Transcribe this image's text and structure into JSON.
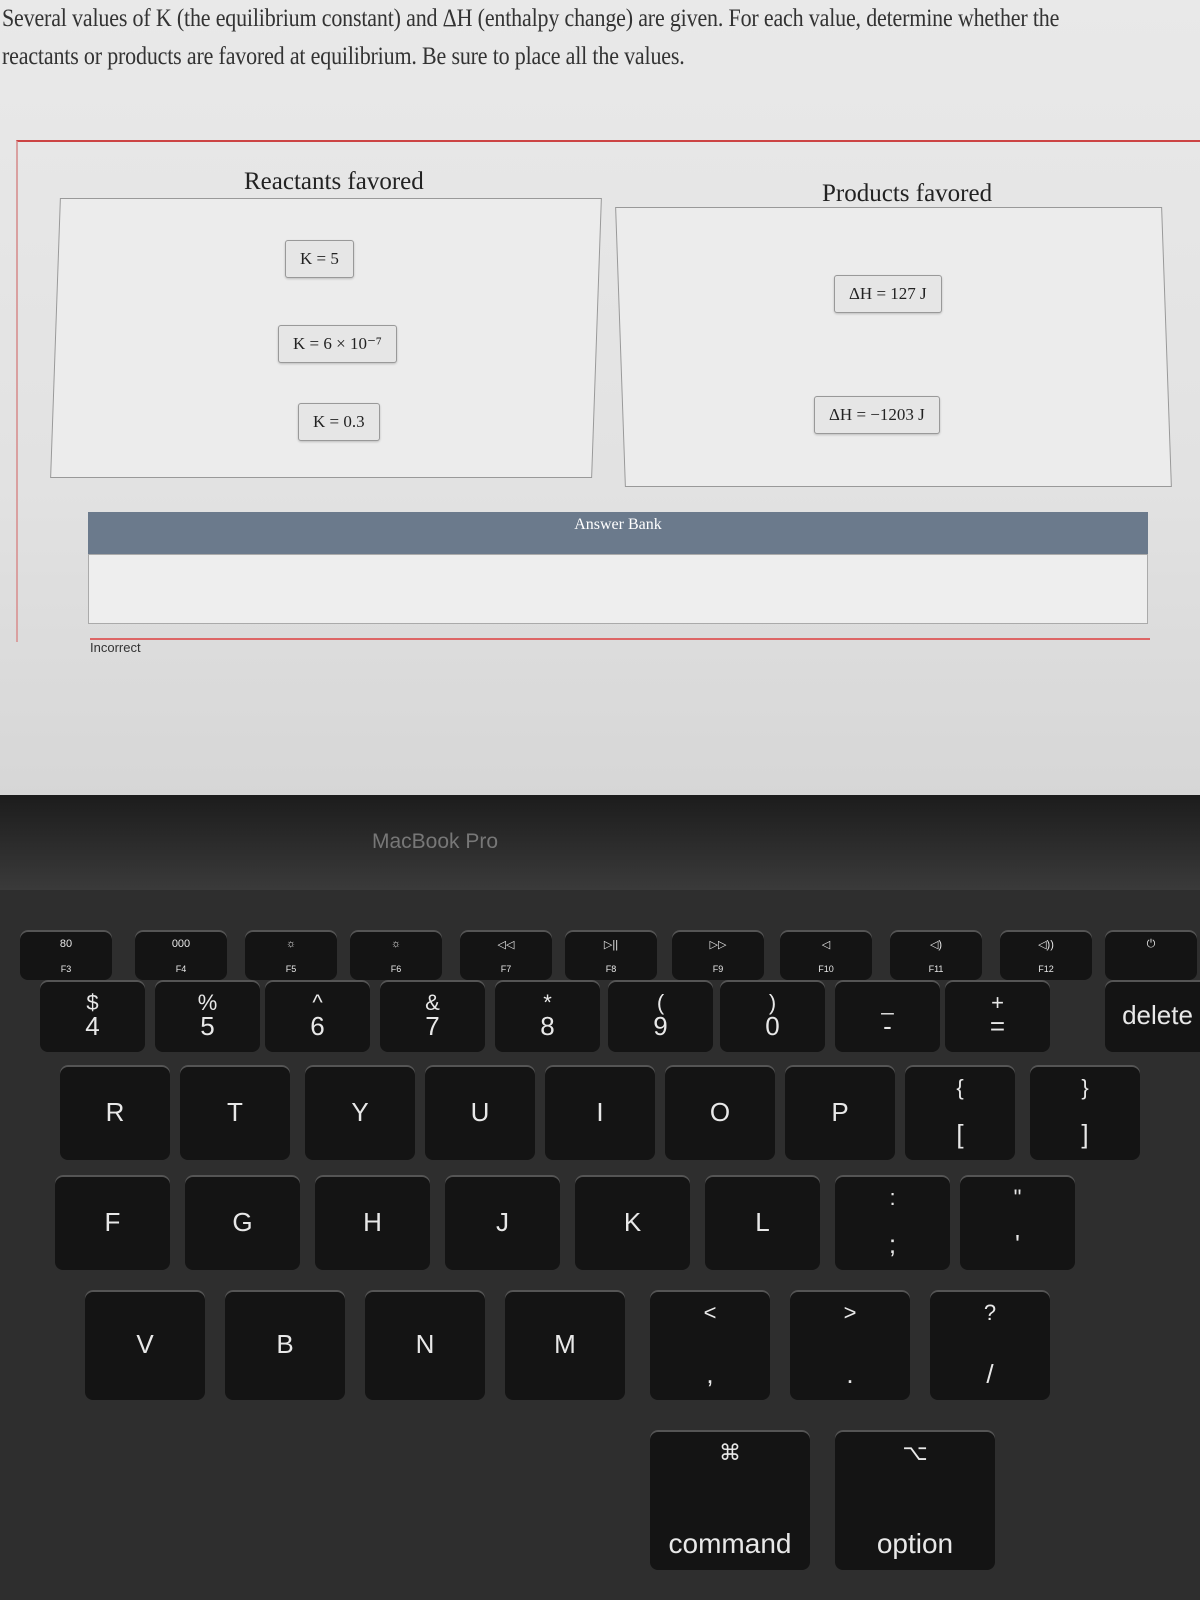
{
  "instructions": "Several values of K (the equilibrium constant) and ΔH (enthalpy change) are given. For each value, determine whether the reactants or products are favored at equilibrium. Be sure to place all the values.",
  "zones": {
    "reactants": {
      "title": "Reactants favored",
      "items": [
        "K = 5",
        "K = 6 × 10⁻⁷",
        "K = 0.3"
      ]
    },
    "products": {
      "title": "Products favored",
      "items": [
        "ΔH = 127 J",
        "ΔH = −1203 J"
      ]
    }
  },
  "answer_bank": {
    "title": "Answer Bank",
    "items": []
  },
  "feedback": "Incorrect",
  "laptop_label": "MacBook Pro",
  "keyboard": {
    "function_row": [
      [
        "80",
        "F3"
      ],
      [
        "000",
        "F4"
      ],
      [
        "☼",
        "F5"
      ],
      [
        "☼",
        "F6"
      ],
      [
        "◁◁",
        "F7"
      ],
      [
        "▷||",
        "F8"
      ],
      [
        "▷▷",
        "F9"
      ],
      [
        "◁",
        "F10"
      ],
      [
        "◁)",
        "F11"
      ],
      [
        "◁))",
        "F12"
      ],
      [
        "⏻",
        ""
      ]
    ],
    "number_row": [
      [
        "$",
        "4"
      ],
      [
        "%",
        "5"
      ],
      [
        "^",
        "6"
      ],
      [
        "&",
        "7"
      ],
      [
        "*",
        "8"
      ],
      [
        "(",
        "9"
      ],
      [
        ")",
        "0"
      ],
      [
        "_",
        "-"
      ],
      [
        "+",
        "="
      ],
      [
        "",
        "delete"
      ]
    ],
    "top_row": [
      [
        "",
        "R"
      ],
      [
        "",
        "T"
      ],
      [
        "",
        "Y"
      ],
      [
        "",
        "U"
      ],
      [
        "",
        "I"
      ],
      [
        "",
        "O"
      ],
      [
        "",
        "P"
      ],
      [
        "{",
        "["
      ],
      [
        "}",
        "]"
      ]
    ],
    "home_row": [
      [
        "",
        "F"
      ],
      [
        "",
        "G"
      ],
      [
        "",
        "H"
      ],
      [
        "",
        "J"
      ],
      [
        "",
        "K"
      ],
      [
        "",
        "L"
      ],
      [
        ":",
        ";"
      ],
      [
        "\"",
        "'"
      ]
    ],
    "bottom_row": [
      [
        "",
        "V"
      ],
      [
        "",
        "B"
      ],
      [
        "",
        "N"
      ],
      [
        "",
        "M"
      ],
      [
        "<",
        ","
      ],
      [
        ">",
        "."
      ],
      [
        "?",
        "/"
      ]
    ],
    "modifiers": [
      [
        "⌘",
        "command"
      ],
      [
        "⌥",
        "option"
      ]
    ]
  },
  "colors": {
    "accent_border": "#cc4444",
    "bank_header": "#6b7a8c"
  }
}
